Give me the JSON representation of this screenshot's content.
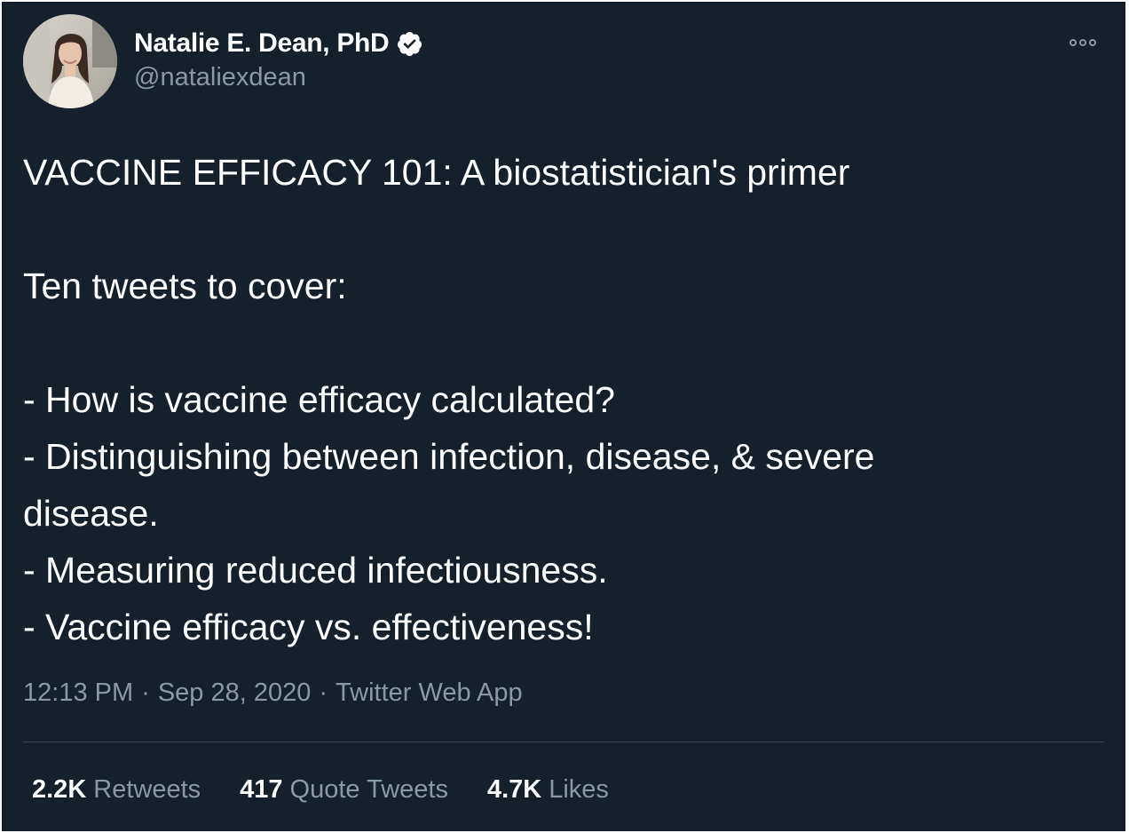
{
  "tweet": {
    "author": {
      "display_name": "Natalie E. Dean, PhD",
      "handle": "@nataliexdean",
      "verified": true
    },
    "lines": [
      "VACCINE EFFICACY 101: A biostatistician's primer",
      "",
      "Ten tweets to cover:",
      "",
      "- How is vaccine efficacy calculated?",
      "- Distinguishing between infection, disease, & severe",
      "disease.",
      "- Measuring reduced infectiousness.",
      "- Vaccine efficacy vs. effectiveness!"
    ],
    "time": "12:13 PM",
    "separator": "·",
    "date": "Sep 28, 2020",
    "source": "Twitter Web App",
    "stats": {
      "retweets_count": "2.2K",
      "retweets_label": "Retweets",
      "quote_tweets_count": "417",
      "quote_tweets_label": "Quote Tweets",
      "likes_count": "4.7K",
      "likes_label": "Likes"
    }
  },
  "icons": {
    "verified": "verified-badge-icon",
    "more": "more-options-icon"
  },
  "colors": {
    "background": "#15202b",
    "text_primary": "#ffffff",
    "text_secondary": "#8899a6",
    "divider": "#38444d"
  }
}
